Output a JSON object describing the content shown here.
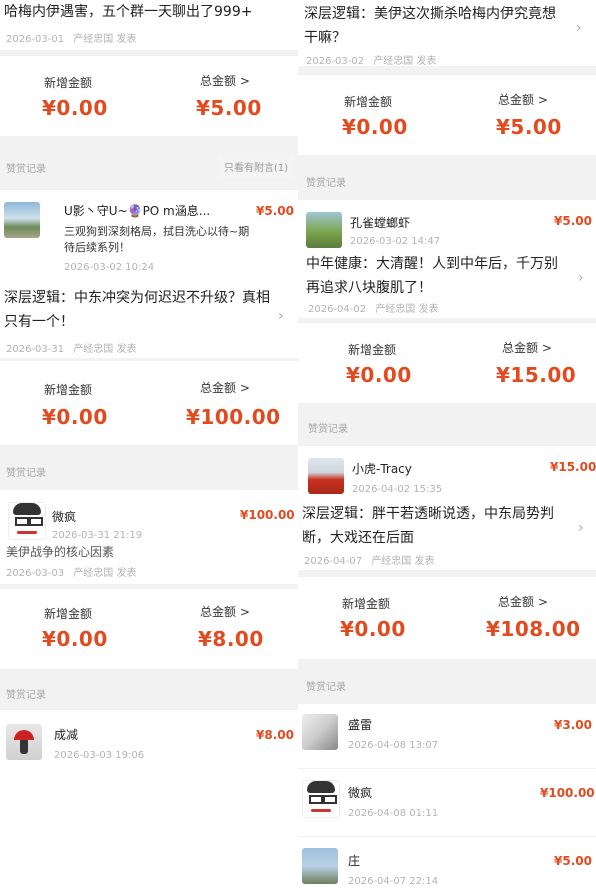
{
  "left": {
    "post1": {
      "title": "哈梅内伊遇害，五个群一天聊出了999+",
      "date": "2026-03-01",
      "source": "产经忠国 发表"
    },
    "sum1": {
      "new_label": "新增金额",
      "total_label": "总金额 >",
      "new_value": "¥0.00",
      "total_value": "¥5.00"
    },
    "record1": {
      "section_label": "赞赏记录",
      "filter_label": "只看有附言(1)",
      "name": "U影丶守U~🔮PO m涵息...",
      "amount": "¥5.00",
      "message": "三观狗到深刻格局，拭目洗心以待~期待后续系列！",
      "time": "2026-03-02 10:24"
    },
    "post2": {
      "title": "深层逻辑：中东冲突为何迟迟不升级？真相只有一个！",
      "date": "2026-03-31",
      "source": "产经忠国 发表"
    },
    "sum2": {
      "new_label": "新增金额",
      "total_label": "总金额 >",
      "new_value": "¥0.00",
      "total_value": "¥100.00"
    },
    "record2": {
      "section_label": "赞赏记录",
      "name": "微疯",
      "amount": "¥100.00",
      "time": "2026-03-31 21:19"
    },
    "post3": {
      "title": "美伊战争的核心因素",
      "date": "2026-03-03",
      "source": "产经忠国 发表"
    },
    "sum3": {
      "new_label": "新增金额",
      "total_label": "总金额 >",
      "new_value": "¥0.00",
      "total_value": "¥8.00"
    },
    "record3": {
      "section_label": "赞赏记录",
      "name": "成减",
      "amount": "¥8.00",
      "time": "2026-03-03 19:06"
    }
  },
  "right": {
    "post1": {
      "title": "深层逻辑：美伊这次撕杀哈梅内伊究竟想干嘛？",
      "date": "2026-03-02",
      "source": "产经忠国 发表"
    },
    "sum1": {
      "new_label": "新增金额",
      "total_label": "总金额 >",
      "new_value": "¥0.00",
      "total_value": "¥5.00"
    },
    "record1": {
      "section_label": "赞赏记录",
      "name": "孔雀螳螂虾",
      "amount": "¥5.00",
      "time": "2026-03-02 14:47"
    },
    "post2": {
      "title": "中年健康：大清醒！人到中年后，千万别再追求八块腹肌了！",
      "date": "2026-04-02",
      "source": "产经忠国 发表"
    },
    "sum2": {
      "new_label": "新增金额",
      "total_label": "总金额 >",
      "new_value": "¥0.00",
      "total_value": "¥15.00"
    },
    "record2": {
      "section_label": "赞赏记录",
      "name": "小虎-Tracy",
      "amount": "¥15.00",
      "time": "2026-04-02 15:35"
    },
    "post3": {
      "title": "深层逻辑：胖干若透晰说透，中东局势判断，大戏还在后面",
      "date": "2026-04-07",
      "source": "产经忠国 发表"
    },
    "sum3": {
      "new_label": "新增金额",
      "total_label": "总金额 >",
      "new_value": "¥0.00",
      "total_value": "¥108.00"
    },
    "record3": {
      "section_label": "赞赏记录",
      "items": [
        {
          "name": "盛雷",
          "amount": "¥3.00",
          "time": "2026-04-08 13:07"
        },
        {
          "name": "微疯",
          "amount": "¥100.00",
          "time": "2026-04-08 01:11"
        },
        {
          "name": "庄",
          "amount": "¥5.00",
          "time": "2026-04-07 22:14"
        }
      ]
    }
  },
  "colors": {
    "accent": "#e24a1f",
    "muted": "#b3b3b3",
    "background": "#f2f2f2",
    "card": "#ffffff"
  },
  "icons": {
    "chevron": "chevron-right-icon"
  }
}
